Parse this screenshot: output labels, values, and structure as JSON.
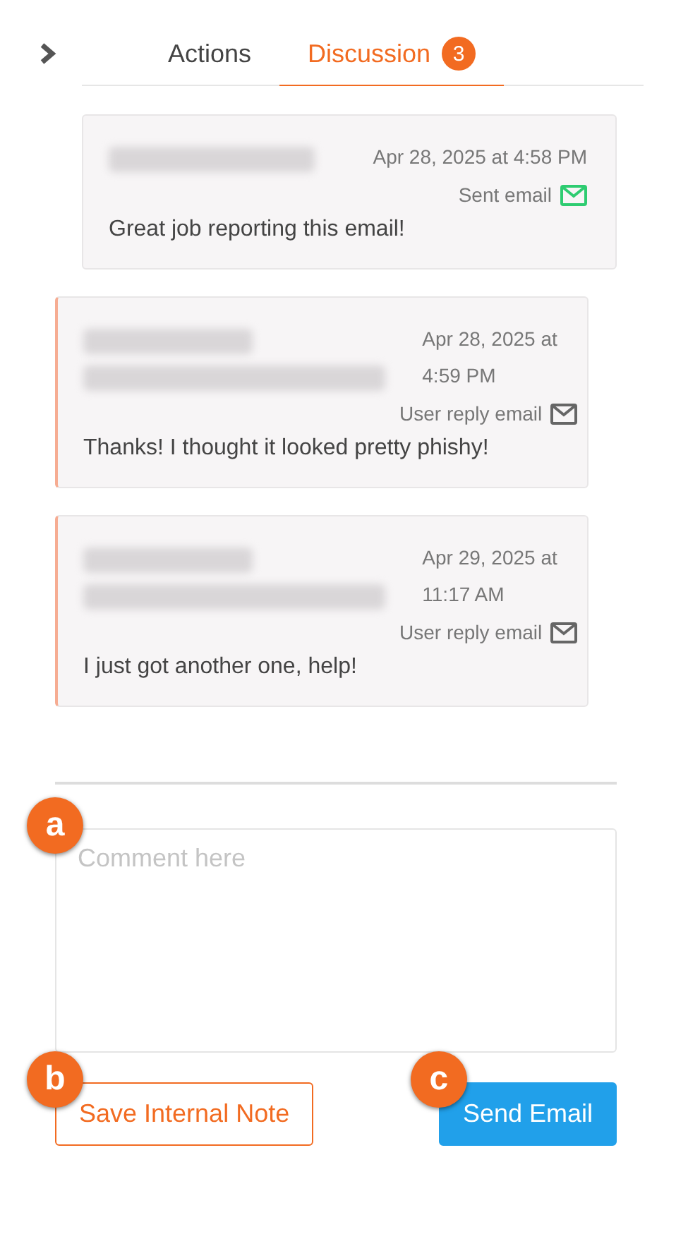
{
  "tabs": [
    {
      "label": "Actions",
      "selected": false
    },
    {
      "label": "Discussion",
      "selected": true,
      "badge": "3"
    }
  ],
  "messages": [
    {
      "kind": "sent",
      "timestamp": "Apr 28, 2025 at 4:58 PM",
      "type_label": "Sent email",
      "body": "Great job reporting this email!"
    },
    {
      "kind": "reply",
      "timestamp": "Apr 28, 2025 at 4:59 PM",
      "type_label": "User reply email",
      "body": "Thanks! I thought it looked pretty phishy!"
    },
    {
      "kind": "reply",
      "timestamp": "Apr 29, 2025 at 11:17 AM",
      "type_label": "User reply email",
      "body": "I just got another one, help!"
    }
  ],
  "comment_field": {
    "placeholder": "Comment here",
    "callout": "a"
  },
  "buttons": [
    {
      "kind": "outline",
      "label": "Save Internal Note",
      "callout": "b"
    },
    {
      "kind": "primary",
      "label": "Send Email",
      "callout": "c"
    }
  ]
}
